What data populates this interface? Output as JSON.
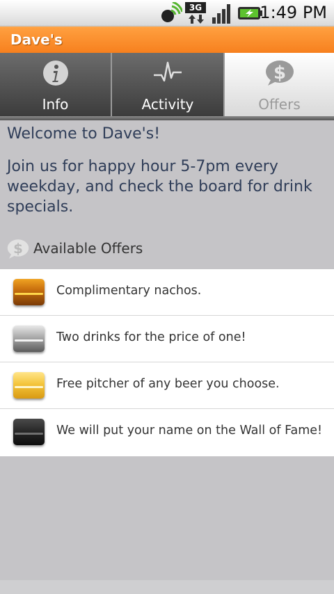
{
  "status_bar": {
    "time": "1:49 PM",
    "network_label": "3G",
    "icons": [
      "gps-satellite-icon",
      "3g-data-icon",
      "signal-strength-icon",
      "battery-charging-icon"
    ]
  },
  "app": {
    "title": "Dave's",
    "accent_color": "#f7801e"
  },
  "tabs": [
    {
      "label": "Info",
      "icon": "info-icon",
      "selected": false
    },
    {
      "label": "Activity",
      "icon": "activity-pulse-icon",
      "selected": false
    },
    {
      "label": "Offers",
      "icon": "dollar-icon",
      "selected": true
    }
  ],
  "content": {
    "welcome": "Welcome to Dave's!",
    "intro": "Join us for happy hour 5-7pm every weekday, and check the board for drink specials.",
    "section_title": "Available Offers",
    "section_icon": "dollar-icon"
  },
  "offers": [
    {
      "text": "Complimentary nachos.",
      "badge": "copper"
    },
    {
      "text": "Two drinks for the price of one!",
      "badge": "silver"
    },
    {
      "text": "Free pitcher of any beer you choose.",
      "badge": "gold"
    },
    {
      "text": "We will put your name on the Wall of Fame!",
      "badge": "black"
    }
  ]
}
